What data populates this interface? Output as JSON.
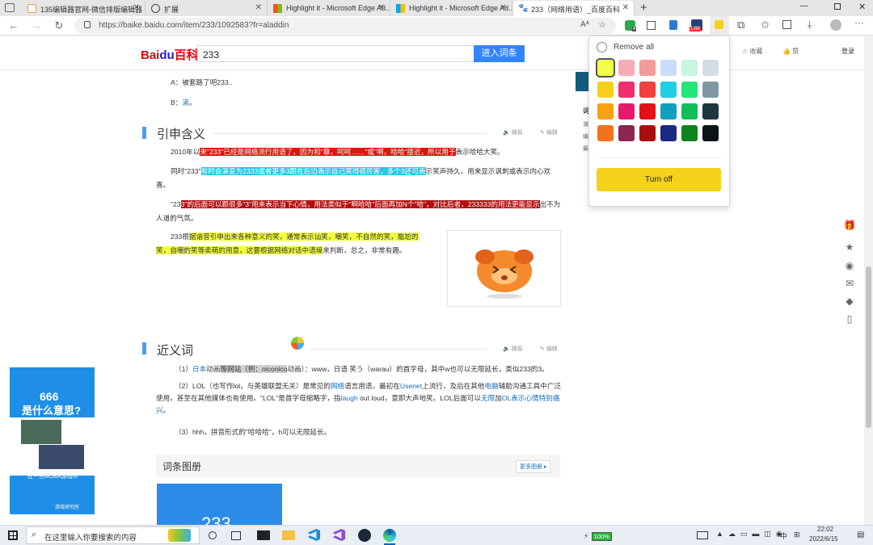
{
  "tabs": [
    {
      "label": "135编辑器官网-微信排版编辑器"
    },
    {
      "label": "扩展"
    },
    {
      "label": "Highlight it - Microsoft Edge Ad..."
    },
    {
      "label": "Highlight it - Microsoft Edge Ad..."
    },
    {
      "label": "233（网络用语）_百度百科"
    }
  ],
  "address": {
    "url": "https://baike.baidu.com/item/233/1092583?fr=aladdin"
  },
  "toolbar": {
    "badge_count": "1:00",
    "badge4": "4"
  },
  "baidu": {
    "logo": "Bai百科",
    "search_value": "233",
    "search_button": "进入词条",
    "collect": "收藏",
    "like": "赞",
    "login": "登录"
  },
  "article": {
    "answer_a": "A：被套路了吧233..",
    "answer_b_prefix": "B：",
    "answer_b_link": "滚",
    "answer_b_suffix": "。",
    "section1_title": "引申含义",
    "read": "播报",
    "edit": "编辑",
    "p1_prefix": "2010年以",
    "p1_hl": "来\"233\"已经是网络流行用语了，因为和\"靠，呵呵……\"或\"啊，哈哈\"接近，所以用于",
    "p1_suffix": "表示哈哈大笑。",
    "p2_prefix": "同时\"233\"",
    "p2_hl": "有时会演变为2333或者更多3跟在后边表示自己笑得很厉害，多个3还可表",
    "p2_suffix": "示笑声持久，用来显示讽刺或表示内心欢喜。",
    "p3_prefix": "\"23",
    "p3_hl": "3\"的后面可以跟很多\"3\"用来表示当下心情，用法类似于\"啊哈哈\"后面再加N个\"哈\"，对比后者，233333的用法更能显示",
    "p3_suffix": "出不为人道的气氛。",
    "p4_prefix": "233根",
    "p4_hl": "据谐音引申出来各种意义的笑，通常表示讪笑，嘲笑，不自然的笑，尴尬的笑，自嘲的笑等卖萌的用意，这要根据网络对话中语境",
    "p4_suffix": "来判断，总之，非常有趣。",
    "section2_title": "近义词",
    "s1_a": "（1）",
    "s1_link1": "日本",
    "s1_b": "动画",
    "s1_hl": "等网站（例：niconico",
    "s1_c": "动画）：www，日语 笑う（warau）的首字母，其中w也可以无限延长，类似233的3。",
    "s2_a": "（2）LOL（也写作lol，与英雄联盟无关）是常见的",
    "s2_link1": "网络",
    "s2_b": "语言用语，最初在",
    "s2_link2": "Usenet",
    "s2_c": "上流行，及后在其他",
    "s2_link3": "电脑",
    "s2_d": "辅助沟通工具中广泛使用，甚至在其他媒体也有使用。\"LOL\"是首字母缩略字，指",
    "s2_link4": "laugh",
    "s2_e": " out loud，意即大声地笑。LOL后面可以",
    "s2_link5": "无限",
    "s2_f": "加",
    "s2_link6": "OL表示心情特别痛兴",
    "s2_g": "。",
    "s3": "（3）hhh，拼音形式的\"哈哈哈\"，h可以无限延长。",
    "album_title": "词条图册",
    "album_more": "更多图册",
    "album_image_text": "233"
  },
  "ad": {
    "line1": "666",
    "line2": "是什么意思?",
    "footer": "在一些MOBA游戏中",
    "brand": "游戏研究所"
  },
  "right_partial": {
    "c1": "词",
    "c2": "演",
    "c3": "编",
    "c4": "最"
  },
  "panel": {
    "remove_all": "Remove all",
    "turn_off": "Turn off",
    "colors": [
      "#f4ff4a",
      "#f8aab8",
      "#f39a9a",
      "#c9dcfb",
      "#c7f5dd",
      "#d5dde3",
      "#f6cf17",
      "#f12f6e",
      "#f2403f",
      "#1fd0e4",
      "#22e67a",
      "#7c98a3",
      "#f8a012",
      "#e8186c",
      "#e31217",
      "#109fc1",
      "#13bd58",
      "#1e3640",
      "#f4721c",
      "#8d2650",
      "#a80f0f",
      "#1c2a86",
      "#0f841b",
      "#0d1518"
    ]
  },
  "taskbar": {
    "search_placeholder": "在这里输入你要搜索的内容",
    "battery": "100%",
    "ime": "中",
    "time": "22:02",
    "date": "2022/6/15"
  }
}
